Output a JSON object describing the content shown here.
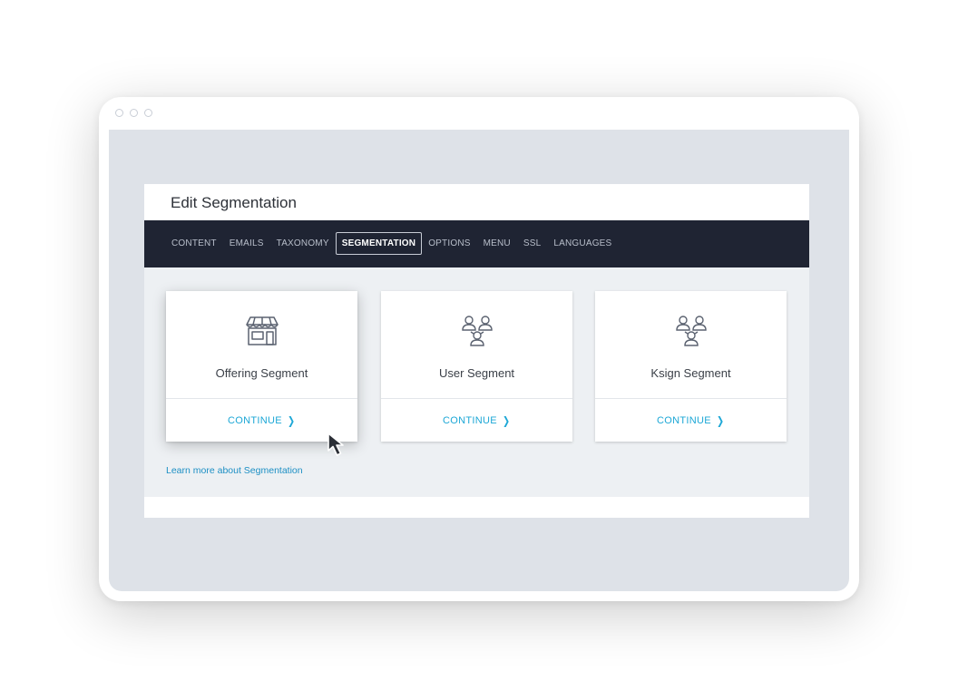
{
  "window": {
    "controls": [
      "dot",
      "dot",
      "dot"
    ]
  },
  "panel": {
    "title": "Edit Segmentation"
  },
  "nav": {
    "tabs": [
      {
        "label": "CONTENT",
        "active": false
      },
      {
        "label": "EMAILS",
        "active": false
      },
      {
        "label": "TAXONOMY",
        "active": false
      },
      {
        "label": "SEGMENTATION",
        "active": true
      },
      {
        "label": "OPTIONS",
        "active": false
      },
      {
        "label": "MENU",
        "active": false
      },
      {
        "label": "SSL",
        "active": false
      },
      {
        "label": "LANGUAGES",
        "active": false
      }
    ]
  },
  "cards": [
    {
      "label": "Offering Segment",
      "icon": "storefront-icon",
      "action": "CONTINUE"
    },
    {
      "label": "User Segment",
      "icon": "user-group-icon",
      "action": "CONTINUE"
    },
    {
      "label": "Ksign Segment",
      "icon": "user-group-icon",
      "action": "CONTINUE"
    }
  ],
  "learn_more": "Learn more about Segmentation",
  "colors": {
    "accent": "#1ca7d6",
    "nav_bg": "#1f2433",
    "page_bg": "#dee2e8",
    "content_bg": "#edf0f3"
  },
  "icons": {
    "chevron": "chevron-right-icon",
    "cursor": "mouse-pointer-icon"
  }
}
